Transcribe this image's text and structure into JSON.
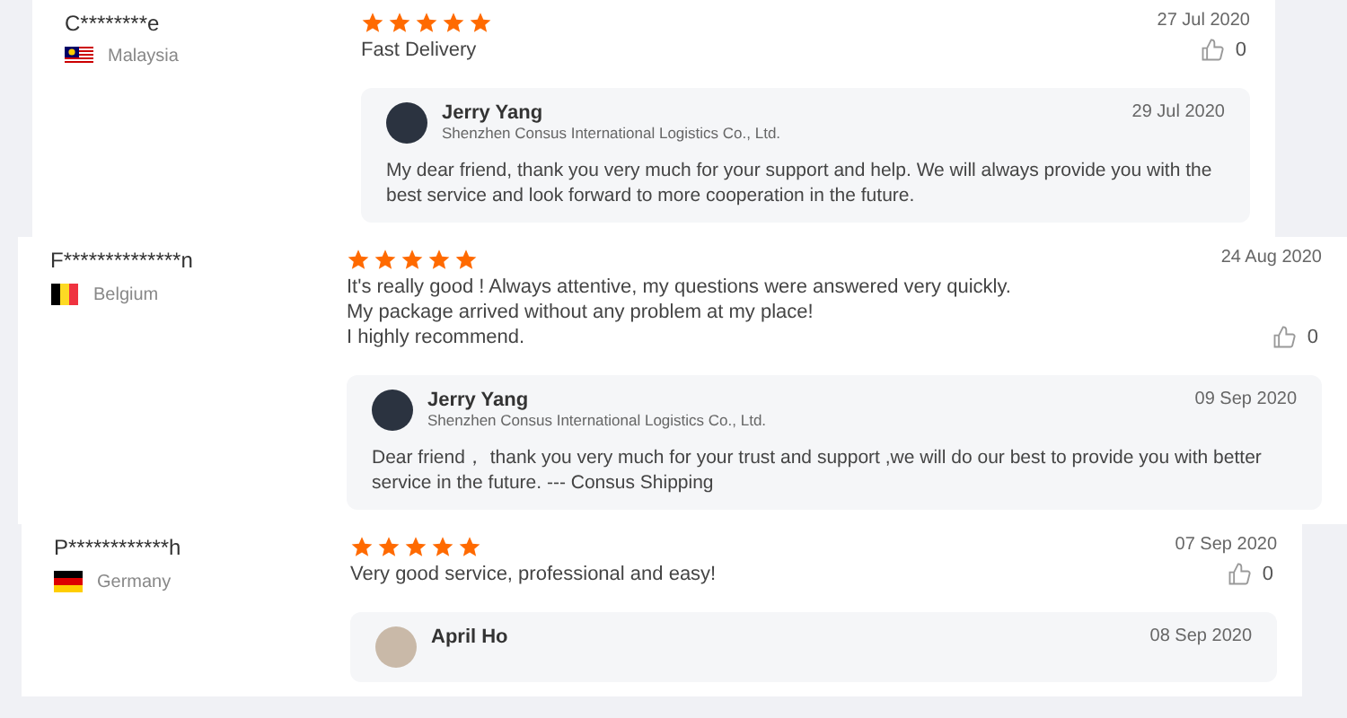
{
  "reviews": [
    {
      "user": "C********e",
      "country": "Malaysia",
      "kind": "my",
      "stars": 5,
      "date": "27 Jul 2020",
      "text": [
        "Fast Delivery"
      ],
      "likes": "0",
      "reply": {
        "name": "Jerry Yang",
        "company": "Shenzhen Consus International Logistics Co., Ltd.",
        "date": "29 Jul 2020",
        "text": "My dear friend, thank you very much for your support and help. We will always provide you with the best service and look forward to more cooperation in the future."
      }
    },
    {
      "user": "F**************n",
      "country": "Belgium",
      "kind": "be",
      "stars": 5,
      "date": "24 Aug 2020",
      "text": [
        "It's really good ! Always attentive, my questions were answered very quickly.",
        "My package arrived without any problem at my place!",
        "I highly recommend."
      ],
      "likes": "0",
      "reply": {
        "name": "Jerry Yang",
        "company": "Shenzhen Consus International Logistics Co., Ltd.",
        "date": "09 Sep 2020",
        "text": "Dear friend， thank you very much for your trust and support ,we will do our best to provide you with better service in the future.          --- Consus Shipping"
      }
    },
    {
      "user": "P************h",
      "country": "Germany",
      "kind": "de",
      "stars": 5,
      "date": "07 Sep 2020",
      "text": [
        "Very good service, professional and easy!"
      ],
      "likes": "0",
      "reply": {
        "name": "April Ho",
        "date": "08 Sep 2020"
      }
    }
  ]
}
